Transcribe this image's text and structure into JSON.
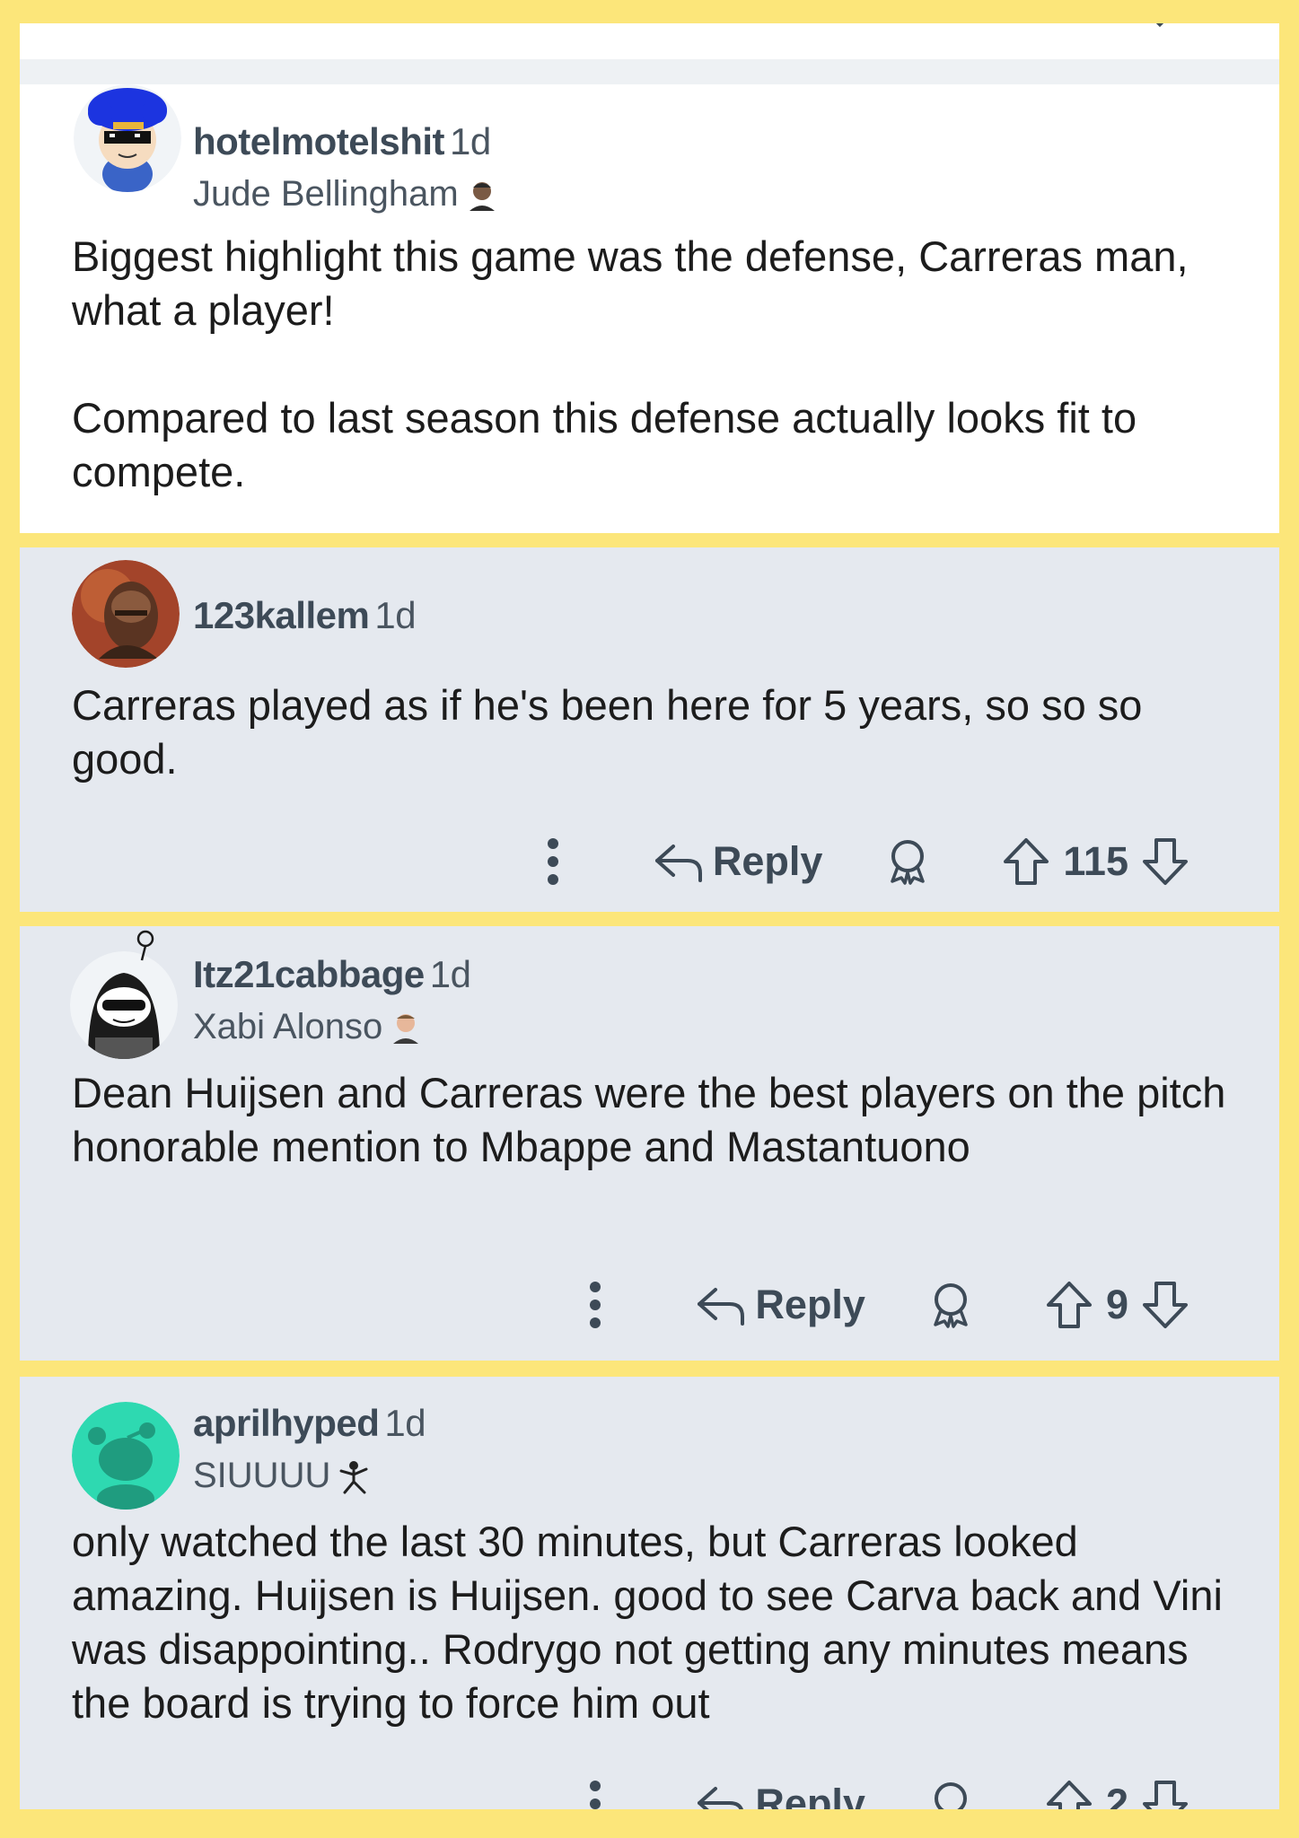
{
  "comments": [
    {
      "username": "hotelmotelshit",
      "age": "1d",
      "flair": "Jude Bellingham",
      "body": [
        "Biggest highlight this game was the defense, Carreras man, what a player!",
        "Compared to last season this defense actually looks fit to compete."
      ]
    },
    {
      "username": "123kallem",
      "age": "1d",
      "flair": "",
      "body": [
        "Carreras played as if he's been here for 5 years, so so so good."
      ],
      "reply_label": "Reply",
      "score": "115"
    },
    {
      "username": "Itz21cabbage",
      "age": "1d",
      "flair": "Xabi Alonso",
      "body": [
        "Dean Huijsen and Carreras were the best players on the pitch honorable mention to Mbappe and Mastantuono"
      ],
      "reply_label": "Reply",
      "score": "9"
    },
    {
      "username": "aprilhyped",
      "age": "1d",
      "flair": "SIUUUU",
      "body": [
        "only watched the last 30 minutes, but Carreras looked amazing. Huijsen is Huijsen. good to see Carva back and Vini was disappointing.. Rodrygo not getting any minutes means the board is trying to force him out"
      ],
      "reply_label": "Reply",
      "score": "2"
    }
  ],
  "icons": [
    "more-options-icon",
    "reply-arrow-icon",
    "award-icon",
    "upvote-icon",
    "downvote-icon",
    "player-flair-icon"
  ],
  "colors": {
    "frame_yellow": "#fce67a",
    "card_white": "#ffffff",
    "card_grey": "#e5e9ef",
    "meta_text": "#3d4a57",
    "body_text": "#1c1c1c"
  }
}
